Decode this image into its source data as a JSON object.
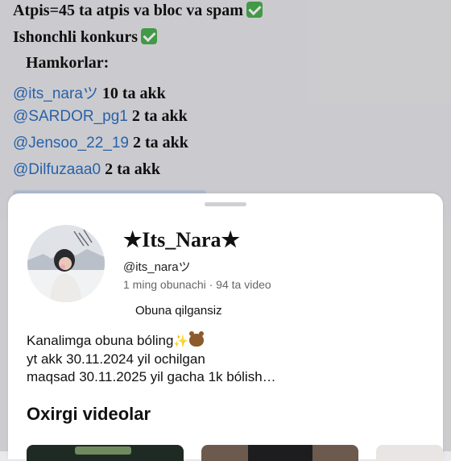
{
  "post": {
    "line1": "Atpis=45 ta atpis va bloc va spam",
    "line2": "Ishonchli konkurs",
    "line3": "Hamkorlar:",
    "partners": [
      {
        "handle": "@its_naraツ",
        "count": " 10 ta  akk"
      },
      {
        "handle": "@SARDOR_pg1",
        "count": " 2 ta akk"
      },
      {
        "handle": "@Jensoo_22_19",
        "count": " 2 ta akk"
      },
      {
        "handle": "@Dilfuzaaa0",
        "count": " 2 ta akk"
      }
    ]
  },
  "channel": {
    "title": "★Its_Nara★",
    "handle": "@its_naraツ",
    "stats": "1 ming obunachi · 94 ta video",
    "subscribed_label": "Obuna qilgansiz",
    "description": [
      "Kanalimga obuna bóling",
      "yt akk 30.11.2024 yil ochilgan",
      "maqsad 30.11.2025 yil gacha 1k bólish…"
    ],
    "recent_videos_title": "Oxirgi videolar"
  },
  "colors": {
    "mention": "#2f6fbf",
    "check": "#4caf50"
  }
}
